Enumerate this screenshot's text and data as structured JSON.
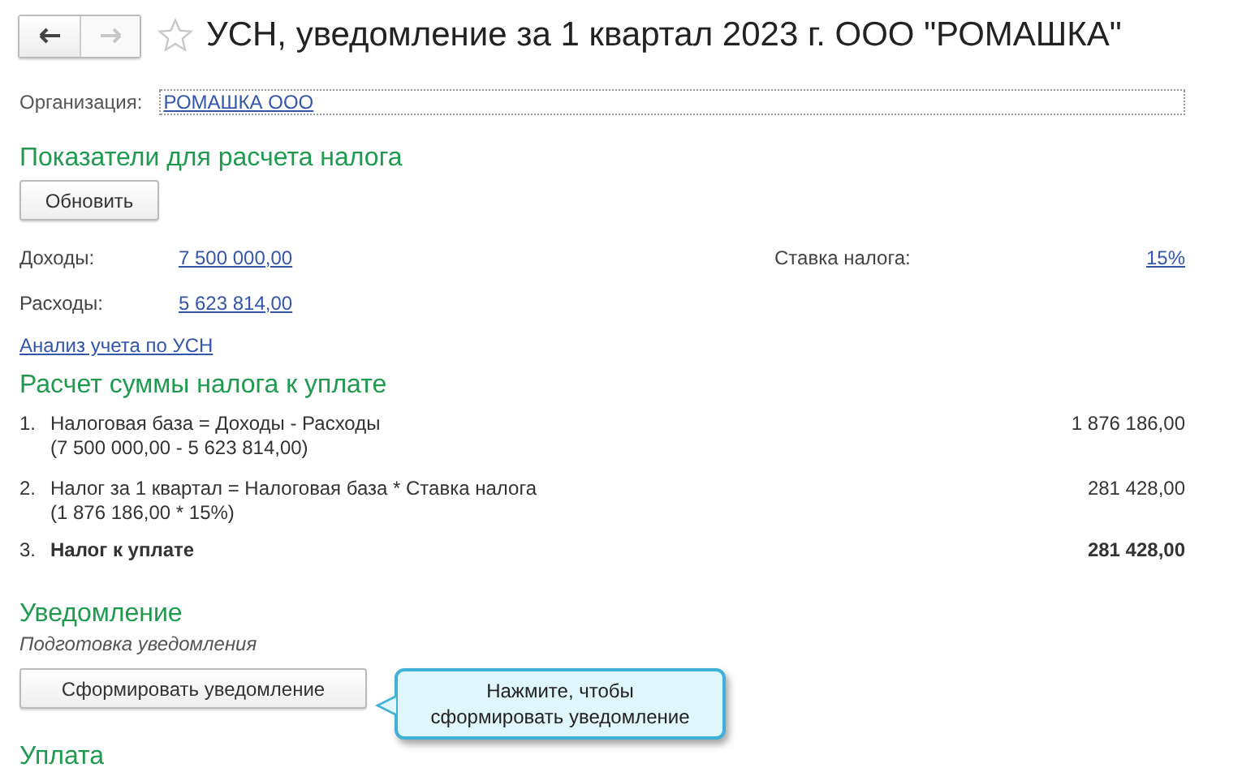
{
  "header": {
    "back_disabled": false,
    "forward_disabled": true,
    "favorite": false,
    "title": "УСН, уведомление за 1 квартал 2023 г. ООО \"РОМАШКА\""
  },
  "organization": {
    "label": "Организация:",
    "value": "РОМАШКА ООО"
  },
  "indicators": {
    "heading": "Показатели для расчета налога",
    "refresh_button": "Обновить",
    "income": {
      "label": "Доходы:",
      "value": "7 500 000,00"
    },
    "rate": {
      "label": "Ставка налога:",
      "value": "15%"
    },
    "expenses": {
      "label": "Расходы:",
      "value": "5 623 814,00"
    },
    "analysis_link": "Анализ учета по УСН"
  },
  "calculation": {
    "heading": "Расчет суммы налога к уплате",
    "items": [
      {
        "number": "1.",
        "text": "Налоговая база = Доходы - Расходы",
        "formula": "(7 500 000,00 - 5 623 814,00)",
        "amount": "1 876 186,00",
        "total": false
      },
      {
        "number": "2.",
        "text": "Налог за 1 квартал = Налоговая база * Ставка налога",
        "formula": "(1 876 186,00 * 15%)",
        "amount": "281 428,00",
        "total": false
      },
      {
        "number": "3.",
        "text": "Налог к уплате",
        "amount": "281 428,00",
        "total": true
      }
    ]
  },
  "notification": {
    "heading": "Уведомление",
    "subtitle": "Подготовка уведомления",
    "button": "Сформировать уведомление",
    "tooltip": "Нажмите, чтобы сформировать уведомление"
  },
  "payment": {
    "heading": "Уплата"
  }
}
